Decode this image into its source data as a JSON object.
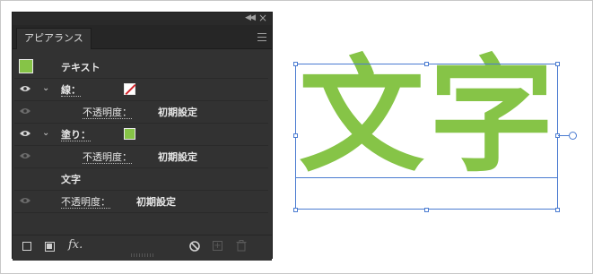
{
  "panel": {
    "tab_label": "アピアランス",
    "header_label": "テキスト",
    "rows": {
      "stroke_label": "線：",
      "stroke_opacity_label": "不透明度：",
      "stroke_opacity_value": "初期設定",
      "fill_label": "塗り：",
      "fill_opacity_label": "不透明度：",
      "fill_opacity_value": "初期設定",
      "chars_label": "文字",
      "opacity_label": "不透明度：",
      "opacity_value": "初期設定"
    },
    "colors": {
      "fill": "#86c447",
      "stroke_none_slash": "#d3222a",
      "panel_bg": "#323232"
    },
    "icons": [
      "visibility-eye-icon",
      "chevron-down-icon",
      "panel-menu-icon",
      "add-stroke-icon",
      "add-fill-icon",
      "fx-icon",
      "clear-appearance-icon",
      "duplicate-item-icon",
      "delete-item-icon"
    ]
  },
  "artboard": {
    "text": "文字",
    "char1": "文",
    "char2": "字",
    "selection_color": "#4a7bd1"
  }
}
